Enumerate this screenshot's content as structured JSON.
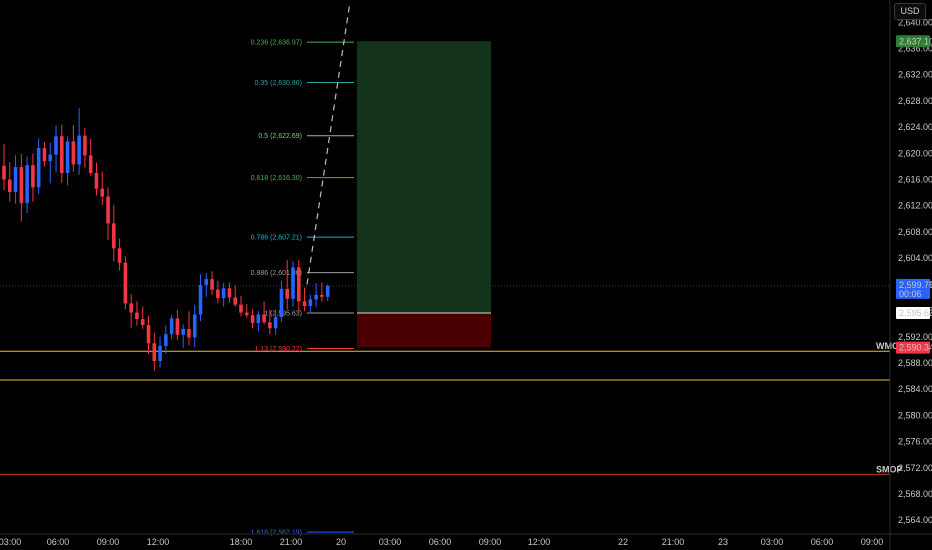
{
  "currency_button": "USD",
  "colors": {
    "background": "#000000",
    "up_candle": "#2962ff",
    "down_candle": "#f23645",
    "long_target_zone": "#12331a",
    "long_stop_zone": "#4a0000",
    "horizontal_line_yellow": "#e6c229",
    "horizontal_line_red": "#c0392b",
    "current_price_label": "#2962ff",
    "target_price_label": "#2e7d32",
    "stop_price_label": "#f23645"
  },
  "chart_data": {
    "type": "candlestick",
    "price_axis": {
      "ticks": [
        "2,640.00",
        "2,636.00",
        "2,632.00",
        "2,628.00",
        "2,624.00",
        "2,620.00",
        "2,616.00",
        "2,612.00",
        "2,608.00",
        "2,604.00",
        "2,600.00",
        "2,596.00",
        "2,592.00",
        "2,588.00",
        "2,584.00",
        "2,580.00",
        "2,576.00",
        "2,572.00",
        "2,568.00",
        "2,564.00"
      ],
      "tick_values": [
        2640,
        2636,
        2632,
        2628,
        2624,
        2620,
        2616,
        2612,
        2608,
        2604,
        2600,
        2596,
        2592,
        2588,
        2584,
        2580,
        2576,
        2572,
        2568,
        2564
      ],
      "range": [
        2561.9,
        2643.4
      ]
    },
    "time_axis": {
      "labels": [
        "03:00",
        "06:00",
        "09:00",
        "12:00",
        "18:00",
        "21:00",
        "20",
        "03:00",
        "06:00",
        "09:00",
        "12:00",
        "22",
        "21:00",
        "23",
        "03:00",
        "06:00",
        "09:00"
      ]
    },
    "fibonacci_levels": [
      {
        "label": "0.236 (2,636.97)",
        "price": 2636.97,
        "color": "#4caf50"
      },
      {
        "label": "0.35 (2,630.80)",
        "price": 2630.8,
        "color": "#26a69a"
      },
      {
        "label": "0.5 (2,622.69)",
        "price": 2622.69,
        "color": "#81c784"
      },
      {
        "label": "0.618 (2,616.30)",
        "price": 2616.3,
        "color": "#4caf50"
      },
      {
        "label": "0.786 (2,607.21)",
        "price": 2607.21,
        "color": "#00bcd4"
      },
      {
        "label": "0.886 (2,601.80)",
        "price": 2601.8,
        "color": "#9e9e9e"
      },
      {
        "label": "1 (2,595.63)",
        "price": 2595.63,
        "color": "#9e9e9e"
      },
      {
        "label": "1.13 (2,590.22)",
        "price": 2590.22,
        "color": "#f23645"
      },
      {
        "label": "1.618 (2,562.19)",
        "price": 2562.19,
        "color": "#2962ff"
      }
    ],
    "horizontal_lines": [
      {
        "name": "WMO",
        "price": 2589.8,
        "color": "#e6c229"
      },
      {
        "name": "",
        "price": 2585.4,
        "color": "#e6c229"
      },
      {
        "name": "SMOP",
        "price": 2571.0,
        "color": "#c0392b"
      }
    ],
    "price_labels": {
      "target": "2,637.10",
      "current": "2,599.76",
      "countdown": "00:06",
      "entry": "2,595.63",
      "stop": "2,590.34"
    },
    "position": {
      "entry": 2595.63,
      "target": 2637.1,
      "stop": 2590.34
    },
    "candles": [
      [
        2618.1,
        2621.4,
        2614.3,
        2616.0
      ],
      [
        2616.0,
        2618.7,
        2612.6,
        2614.1
      ],
      [
        2614.1,
        2619.7,
        2612.3,
        2617.9
      ],
      [
        2617.9,
        2619.9,
        2609.6,
        2612.4
      ],
      [
        2612.4,
        2619.5,
        2610.9,
        2618.2
      ],
      [
        2618.2,
        2620.0,
        2612.6,
        2614.8
      ],
      [
        2614.8,
        2622.3,
        2613.8,
        2620.8
      ],
      [
        2620.8,
        2621.7,
        2618.0,
        2618.8
      ],
      [
        2618.8,
        2621.6,
        2615.4,
        2619.8
      ],
      [
        2619.8,
        2624.2,
        2617.1,
        2622.6
      ],
      [
        2622.6,
        2624.4,
        2615.5,
        2617.0
      ],
      [
        2617.0,
        2622.6,
        2615.1,
        2621.8
      ],
      [
        2621.8,
        2624.3,
        2617.2,
        2618.3
      ],
      [
        2618.3,
        2626.9,
        2616.7,
        2622.7
      ],
      [
        2622.7,
        2623.9,
        2617.8,
        2619.7
      ],
      [
        2619.7,
        2622.2,
        2616.6,
        2617.0
      ],
      [
        2617.0,
        2618.6,
        2613.6,
        2614.6
      ],
      [
        2614.6,
        2617.2,
        2612.1,
        2613.4
      ],
      [
        2613.4,
        2614.8,
        2606.8,
        2609.3
      ],
      [
        2609.3,
        2612.1,
        2603.5,
        2605.5
      ],
      [
        2605.5,
        2607.0,
        2602.1,
        2603.3
      ],
      [
        2603.3,
        2604.3,
        2596.2,
        2597.1
      ],
      [
        2597.1,
        2598.5,
        2593.4,
        2595.7
      ],
      [
        2595.7,
        2597.4,
        2593.7,
        2594.7
      ],
      [
        2594.7,
        2596.6,
        2593.2,
        2593.8
      ],
      [
        2593.8,
        2595.2,
        2589.4,
        2591.0
      ],
      [
        2591.0,
        2592.6,
        2586.8,
        2588.3
      ],
      [
        2588.3,
        2592.0,
        2587.3,
        2590.6
      ],
      [
        2590.6,
        2593.7,
        2589.4,
        2592.4
      ],
      [
        2592.4,
        2595.3,
        2591.6,
        2594.8
      ],
      [
        2594.8,
        2596.1,
        2591.5,
        2592.3
      ],
      [
        2592.3,
        2593.9,
        2590.3,
        2593.2
      ],
      [
        2593.2,
        2595.9,
        2590.7,
        2591.9
      ],
      [
        2591.9,
        2596.9,
        2590.4,
        2595.4
      ],
      [
        2595.4,
        2601.5,
        2594.4,
        2599.9
      ],
      [
        2599.9,
        2601.7,
        2598.1,
        2600.8
      ],
      [
        2600.8,
        2602.0,
        2598.4,
        2599.2
      ],
      [
        2599.2,
        2600.5,
        2597.1,
        2597.9
      ],
      [
        2597.9,
        2600.2,
        2596.6,
        2599.4
      ],
      [
        2599.4,
        2600.3,
        2597.2,
        2598.0
      ],
      [
        2598.0,
        2599.8,
        2596.6,
        2596.9
      ],
      [
        2596.9,
        2598.2,
        2595.1,
        2595.7
      ],
      [
        2595.7,
        2597.0,
        2594.9,
        2595.3
      ],
      [
        2595.3,
        2596.2,
        2593.3,
        2594.1
      ],
      [
        2594.1,
        2595.9,
        2592.8,
        2595.4
      ],
      [
        2595.4,
        2597.4,
        2593.9,
        2594.2
      ],
      [
        2594.2,
        2596.1,
        2592.4,
        2593.3
      ],
      [
        2593.3,
        2596.1,
        2592.3,
        2595.0
      ],
      [
        2595.0,
        2600.5,
        2594.3,
        2599.3
      ],
      [
        2599.3,
        2603.7,
        2596.2,
        2597.8
      ],
      [
        2597.8,
        2603.5,
        2596.6,
        2602.6
      ],
      [
        2602.6,
        2603.7,
        2595.8,
        2597.4
      ],
      [
        2597.4,
        2599.5,
        2595.9,
        2596.7
      ],
      [
        2596.7,
        2598.4,
        2595.6,
        2597.7
      ],
      [
        2597.7,
        2600.2,
        2596.5,
        2598.4
      ],
      [
        2598.4,
        2600.3,
        2597.4,
        2598.1
      ],
      [
        2598.1,
        2600.0,
        2597.5,
        2599.8
      ]
    ]
  }
}
